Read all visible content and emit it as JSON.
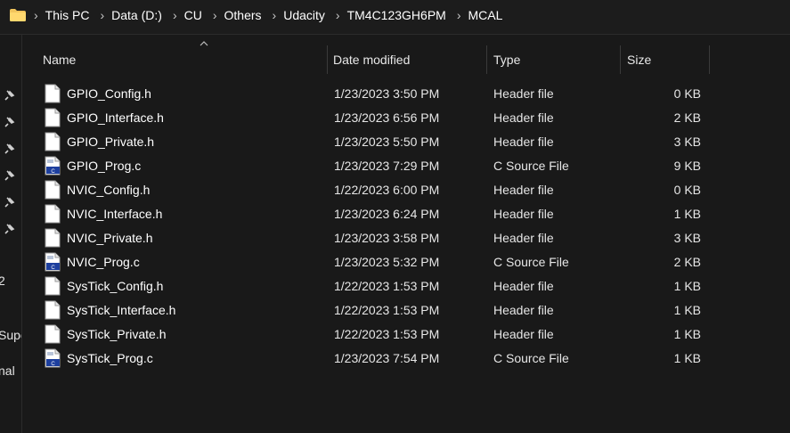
{
  "breadcrumb": {
    "items": [
      "This PC",
      "Data (D:)",
      "CU",
      "Others",
      "Udacity",
      "TM4C123GH6PM",
      "MCAL"
    ]
  },
  "nav": {
    "truncated_labels": [
      "2",
      "Supe",
      "nal"
    ]
  },
  "columns": {
    "name": "Name",
    "date": "Date modified",
    "type": "Type",
    "size": "Size"
  },
  "files": [
    {
      "name": "GPIO_Config.h",
      "date": "1/23/2023 3:50 PM",
      "type": "Header file",
      "size": "0 KB",
      "icon": "header-file-icon"
    },
    {
      "name": "GPIO_Interface.h",
      "date": "1/23/2023 6:56 PM",
      "type": "Header file",
      "size": "2 KB",
      "icon": "header-file-icon"
    },
    {
      "name": "GPIO_Private.h",
      "date": "1/23/2023 5:50 PM",
      "type": "Header file",
      "size": "3 KB",
      "icon": "header-file-icon"
    },
    {
      "name": "GPIO_Prog.c",
      "date": "1/23/2023 7:29 PM",
      "type": "C Source File",
      "size": "9 KB",
      "icon": "c-source-file-icon"
    },
    {
      "name": "NVIC_Config.h",
      "date": "1/22/2023 6:00 PM",
      "type": "Header file",
      "size": "0 KB",
      "icon": "header-file-icon"
    },
    {
      "name": "NVIC_Interface.h",
      "date": "1/23/2023 6:24 PM",
      "type": "Header file",
      "size": "1 KB",
      "icon": "header-file-icon"
    },
    {
      "name": "NVIC_Private.h",
      "date": "1/23/2023 3:58 PM",
      "type": "Header file",
      "size": "3 KB",
      "icon": "header-file-icon"
    },
    {
      "name": "NVIC_Prog.c",
      "date": "1/23/2023 5:32 PM",
      "type": "C Source File",
      "size": "2 KB",
      "icon": "c-source-file-icon"
    },
    {
      "name": "SysTick_Config.h",
      "date": "1/22/2023 1:53 PM",
      "type": "Header file",
      "size": "1 KB",
      "icon": "header-file-icon"
    },
    {
      "name": "SysTick_Interface.h",
      "date": "1/22/2023 1:53 PM",
      "type": "Header file",
      "size": "1 KB",
      "icon": "header-file-icon"
    },
    {
      "name": "SysTick_Private.h",
      "date": "1/22/2023 1:53 PM",
      "type": "Header file",
      "size": "1 KB",
      "icon": "header-file-icon"
    },
    {
      "name": "SysTick_Prog.c",
      "date": "1/23/2023 7:54 PM",
      "type": "C Source File",
      "size": "1 KB",
      "icon": "c-source-file-icon"
    }
  ]
}
